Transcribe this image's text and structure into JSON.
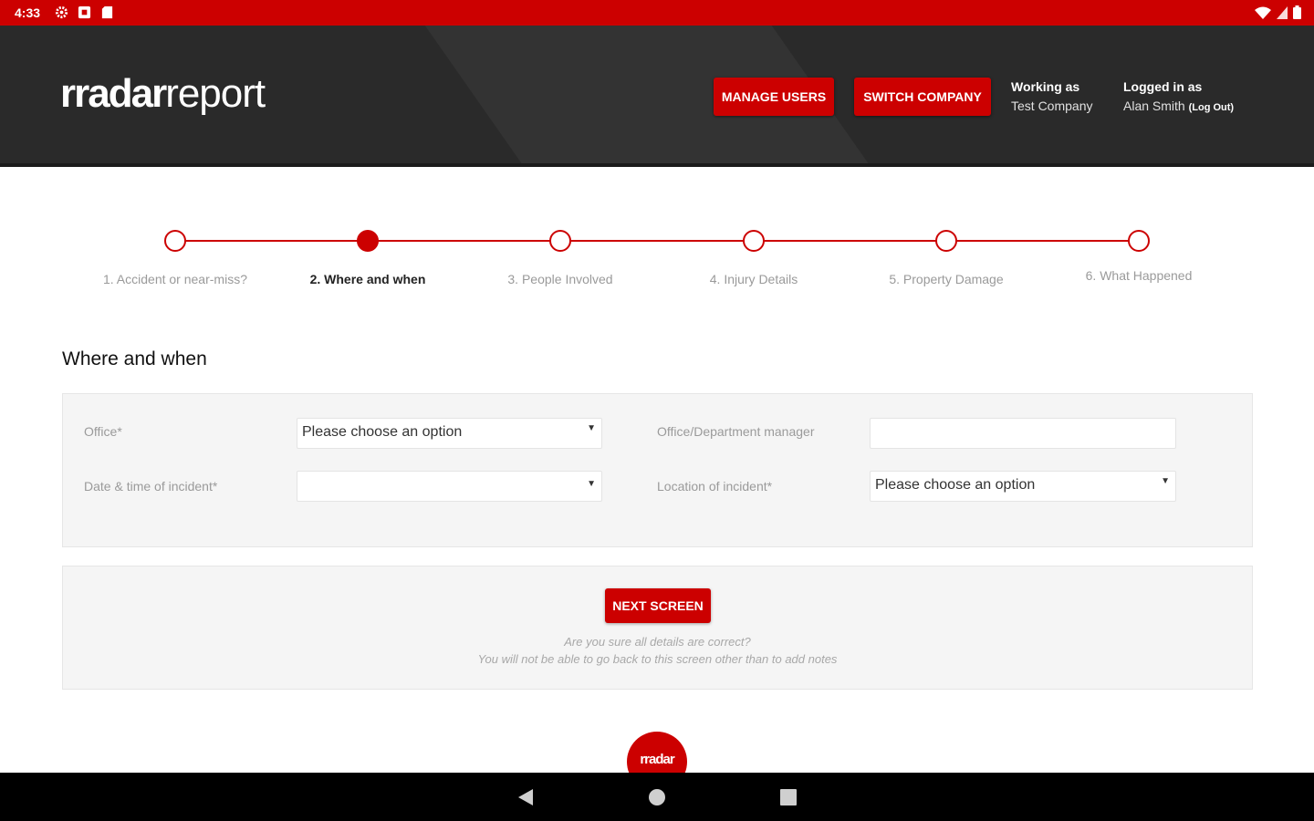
{
  "colors": {
    "brand_red": "#cc0000",
    "header_bg": "#2a2a2a",
    "panel_bg": "#f5f5f5"
  },
  "statusbar": {
    "time": "4:33",
    "left_icons": [
      "gear-icon",
      "square-notification-icon",
      "sd-card-icon"
    ],
    "right_icons": [
      "wifi-icon",
      "signal-icon",
      "battery-icon"
    ]
  },
  "header": {
    "logo_bold": "rradar",
    "logo_light": "report",
    "manage_users_label": "MANAGE USERS",
    "switch_company_label": "SWITCH COMPANY",
    "working_as_label": "Working as",
    "working_as_value": "Test Company",
    "logged_in_label": "Logged in as",
    "logged_in_value": "Alan Smith",
    "logout_label": "(Log Out)"
  },
  "stepper": {
    "active_index": 1,
    "steps": [
      {
        "label": "1. Accident or near-miss?"
      },
      {
        "label": "2. Where and when"
      },
      {
        "label": "3. People Involved"
      },
      {
        "label": "4. Injury Details"
      },
      {
        "label": "5. Property Damage"
      },
      {
        "label": "6. What Happened"
      }
    ]
  },
  "section_title": "Where and when",
  "form": {
    "office_label": "Office*",
    "office_value": "Please choose an option",
    "manager_label": "Office/Department manager",
    "manager_value": "",
    "datetime_label": "Date & time of incident*",
    "datetime_value": "",
    "location_label": "Location of incident*",
    "location_value": "Please choose an option"
  },
  "next": {
    "button_label": "NEXT SCREEN",
    "note_line1": "Are you sure all details are correct?",
    "note_line2": "You will not be able to go back to this screen other than to add notes"
  },
  "footer": {
    "badge_text": "rradar"
  },
  "navbar": {
    "icons": [
      "back-icon",
      "home-icon",
      "recents-icon"
    ]
  }
}
